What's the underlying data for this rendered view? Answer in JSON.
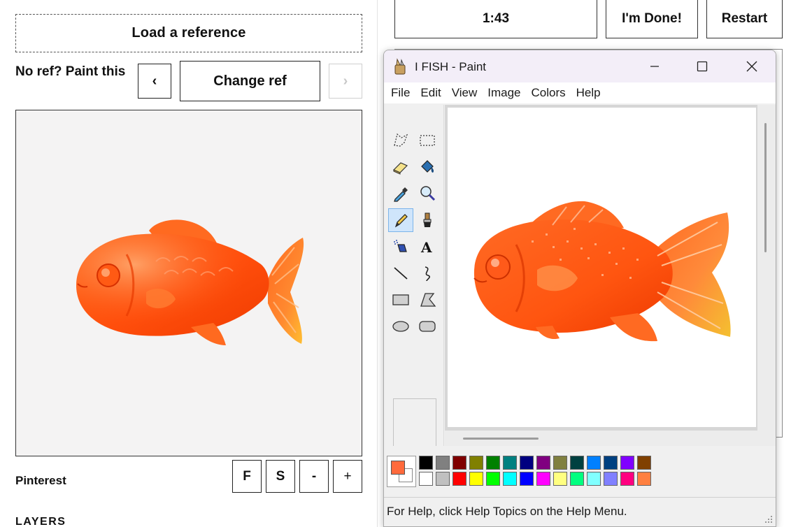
{
  "reference_panel": {
    "load_label": "Load a reference",
    "no_ref_label": "No ref? Paint this",
    "prev_label": "‹",
    "change_label": "Change ref",
    "next_label": "›",
    "image_subject": "orange gummy fish",
    "source_label": "Pinterest",
    "controls": [
      "F",
      "S",
      "-",
      "+"
    ],
    "layers_label": "LAYERS"
  },
  "top_bar": {
    "timer": "1:43",
    "done_label": "I'm Done!",
    "restart_label": "Restart"
  },
  "paint": {
    "title": "I FISH - Paint",
    "menu": [
      "File",
      "Edit",
      "View",
      "Image",
      "Colors",
      "Help"
    ],
    "tools": [
      "free-select",
      "rect-select",
      "eraser",
      "fill",
      "color-picker",
      "magnifier",
      "pencil",
      "brush",
      "airbrush",
      "text",
      "line",
      "curve",
      "rectangle",
      "polygon",
      "ellipse",
      "rounded-rectangle"
    ],
    "selected_tool": "pencil",
    "canvas_subject": "pixel-art orange fish",
    "foreground_color": "#ff6a3c",
    "background_color": "#ffffff",
    "palette_top": [
      "#000000",
      "#808080",
      "#800000",
      "#808000",
      "#008000",
      "#008080",
      "#000080",
      "#800080",
      "#808040",
      "#004040",
      "#0080ff",
      "#004080",
      "#8000ff",
      "#804000"
    ],
    "palette_bottom": [
      "#ffffff",
      "#c0c0c0",
      "#ff0000",
      "#ffff00",
      "#00ff00",
      "#00ffff",
      "#0000ff",
      "#ff00ff",
      "#ffff80",
      "#00ff80",
      "#80ffff",
      "#8080ff",
      "#ff0080",
      "#ff8040"
    ],
    "status": "For Help, click Help Topics on the Help Menu."
  },
  "colors": {
    "fish_orange": "#ff5a14",
    "fish_light": "#ff9a3a",
    "fish_yellow": "#ffc22a",
    "titlebar_bg": "#f3eef8"
  }
}
